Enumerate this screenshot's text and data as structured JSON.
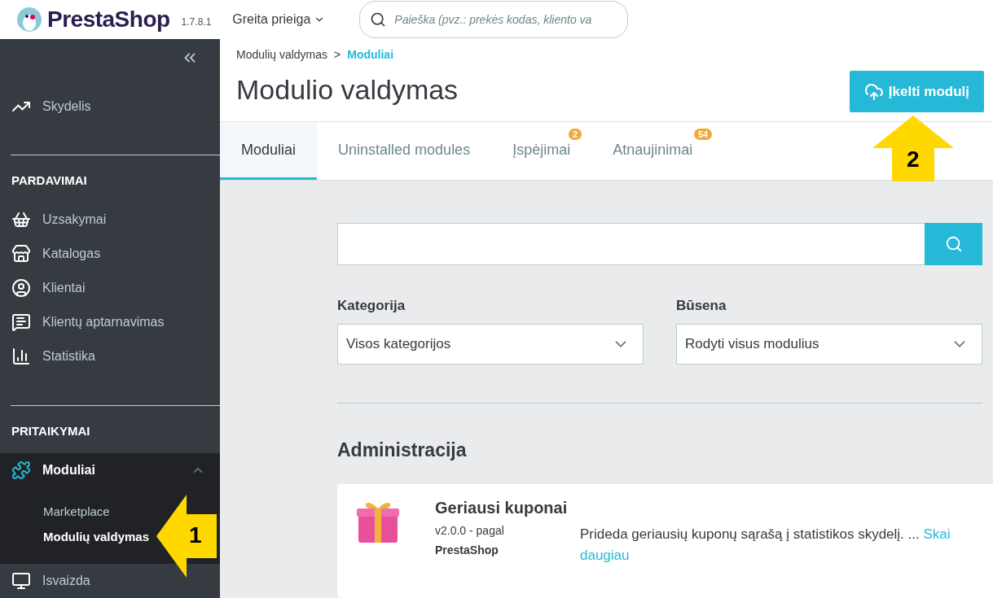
{
  "header": {
    "logo": "PrestaShop",
    "version": "1.7.8.1",
    "quick_access": "Greita prieiga",
    "search": {
      "placeholder": "Paieška (pvz.: prekės kodas, kliento va"
    }
  },
  "sidebar": {
    "top_items": [
      {
        "label": "Skydelis",
        "selected": false
      }
    ],
    "sections": [
      {
        "title": "PARDAVIMAI",
        "items": [
          {
            "label": "Uzsakymai",
            "selected": false
          },
          {
            "label": "Katalogas",
            "selected": false
          },
          {
            "label": "Klientai",
            "selected": false
          },
          {
            "label": "Klientų aptarnavimas",
            "selected": false
          },
          {
            "label": "Statistika",
            "selected": false
          }
        ]
      },
      {
        "title": "PRITAIKYMAI",
        "items": [
          {
            "label": "Moduliai",
            "selected": true,
            "expanded": true,
            "children": [
              {
                "label": "Marketplace",
                "selected": false
              },
              {
                "label": "Modulių valdymas",
                "selected": true
              }
            ]
          },
          {
            "label": "Isvaizda",
            "selected": false
          }
        ]
      }
    ]
  },
  "breadcrumb": [
    {
      "label": "Modulių valdymas",
      "selected": false
    },
    {
      "label": "Moduliai",
      "selected": true
    }
  ],
  "breadcrumb_separator": ">",
  "page_title": "Modulio valdymas",
  "upload_button": "Įkelti modulį",
  "tabs": [
    {
      "label": "Moduliai",
      "selected": true
    },
    {
      "label": "Uninstalled modules",
      "selected": false
    },
    {
      "label": "Įspėjimai",
      "selected": false,
      "badge": "2"
    },
    {
      "label": "Atnaujinimai",
      "selected": false,
      "badge": "54"
    }
  ],
  "filters": [
    {
      "label": "Kategorija",
      "value": "Visos kategorijos"
    },
    {
      "label": "Būsena",
      "value": "Rodyti visus modulius"
    }
  ],
  "section_title": "Administracija",
  "module": {
    "name": "Geriausi kuponai",
    "version": "v2.0.0 - pagal",
    "author": "PrestaShop",
    "description": "Prideda geriausių kuponų sąrašą į statistikos skydelį. ...",
    "read_more": [
      "Skai",
      "daugiau"
    ]
  },
  "annotations": [
    {
      "number": "1",
      "kind": "leftarrow"
    },
    {
      "number": "2",
      "kind": "uparrow"
    }
  ]
}
